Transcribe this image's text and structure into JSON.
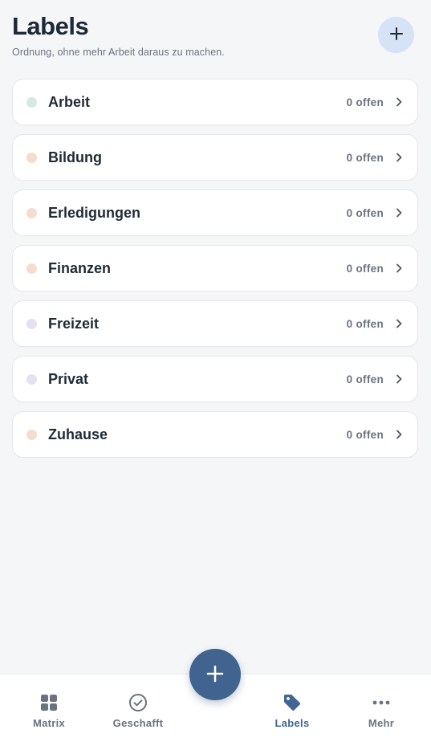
{
  "header": {
    "title": "Labels",
    "subtitle": "Ordnung, ohne mehr Arbeit daraus zu machen."
  },
  "colors": {
    "accent": "#40638f",
    "add_button_bg": "#d6e2f6",
    "dot_green": "#d4e9e1",
    "dot_peach": "#f6dccc",
    "dot_lavender": "#e6e0f3"
  },
  "labels": [
    {
      "name": "Arbeit",
      "count": "0 offen",
      "dot": "#d4e9e1"
    },
    {
      "name": "Bildung",
      "count": "0 offen",
      "dot": "#f6dccc"
    },
    {
      "name": "Erledigungen",
      "count": "0 offen",
      "dot": "#f6dccc"
    },
    {
      "name": "Finanzen",
      "count": "0 offen",
      "dot": "#f6dccc"
    },
    {
      "name": "Freizeit",
      "count": "0 offen",
      "dot": "#e6e0f3"
    },
    {
      "name": "Privat",
      "count": "0 offen",
      "dot": "#e6e0f3"
    },
    {
      "name": "Zuhause",
      "count": "0 offen",
      "dot": "#f6dccc"
    }
  ],
  "nav": {
    "items": [
      {
        "label": "Matrix",
        "icon": "grid-icon",
        "active": false
      },
      {
        "label": "Geschafft",
        "icon": "check-circle-icon",
        "active": false
      },
      {
        "label": "Labels",
        "icon": "tag-icon",
        "active": true
      },
      {
        "label": "Mehr",
        "icon": "more-dots-icon",
        "active": false
      }
    ]
  }
}
